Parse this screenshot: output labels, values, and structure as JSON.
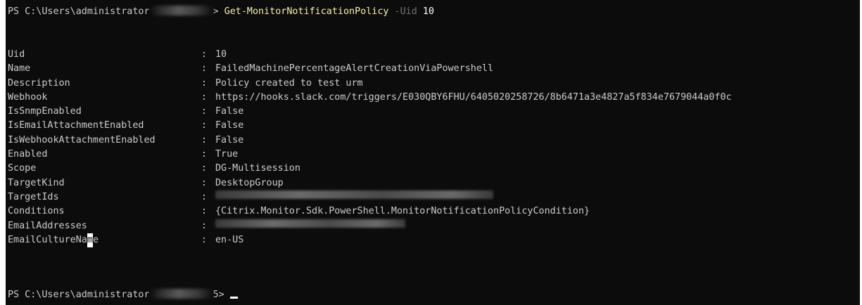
{
  "console": {
    "prompt_prefix": "PS C:\\Users\\administrator",
    "prompt_suffix_1": "> ",
    "command": "Get-MonitorNotificationPolicy",
    "param_name": "-Uid",
    "param_value": "10",
    "prompt_suffix_2": "5> ",
    "colors": {
      "background": "#0c0c0c",
      "text": "#cccccc",
      "command": "#f9f1a5",
      "parameter": "#767676"
    }
  },
  "properties": [
    {
      "key": "Uid",
      "value": "10"
    },
    {
      "key": "Name",
      "value": "FailedMachinePercentageAlertCreationViaPowershell"
    },
    {
      "key": "Description",
      "value": "Policy created to test urm"
    },
    {
      "key": "Webhook",
      "value": "https://hooks.slack.com/triggers/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"
    },
    {
      "key": "IsSnmpEnabled",
      "value": "False"
    },
    {
      "key": "IsEmailAttachmentEnabled",
      "value": "False"
    },
    {
      "key": "IsWebhookAttachmentEnabled",
      "value": "False"
    },
    {
      "key": "Enabled",
      "value": "True"
    },
    {
      "key": "Scope",
      "value": "DG-Multisession"
    },
    {
      "key": "TargetKind",
      "value": "DesktopGroup"
    },
    {
      "key": "TargetIds",
      "value": ""
    },
    {
      "key": "Conditions",
      "value": "{Citrix.Monitor.Sdk.PowerShell.MonitorNotificationPolicyCondition}"
    },
    {
      "key": "EmailAddresses",
      "value": ""
    },
    {
      "key": "EmailCultureName_a",
      "value": "EmailCultureNa"
    },
    {
      "key": "EmailCultureName_b",
      "value": "m"
    },
    {
      "key": "EmailCultureName_c",
      "value": "e"
    },
    {
      "key": "EmailCultureName_val",
      "value": "en-US"
    }
  ],
  "separator": ": "
}
